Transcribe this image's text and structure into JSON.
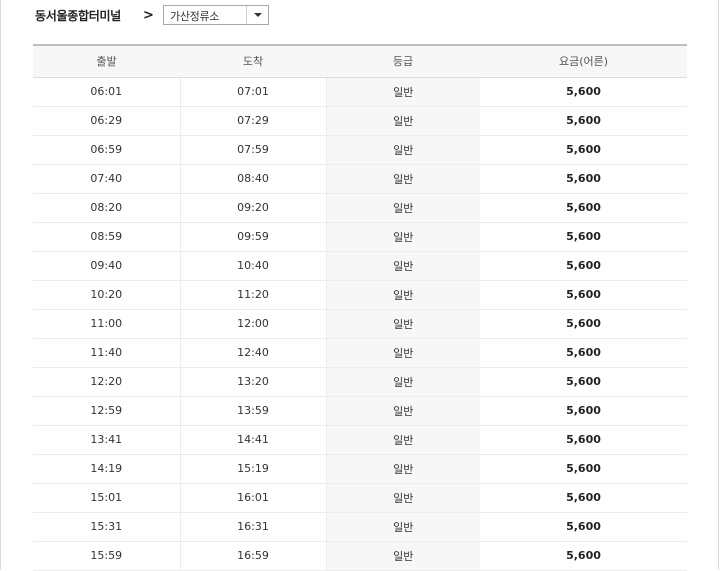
{
  "route": {
    "origin": "동서울종합터미널",
    "arrow": ">",
    "destination_select": {
      "value": "가산정류소"
    }
  },
  "table": {
    "headers": {
      "departure": "출발",
      "arrival": "도착",
      "grade": "등급",
      "fare": "요금(어른)"
    },
    "rows": [
      {
        "departure": "06:01",
        "arrival": "07:01",
        "grade": "일반",
        "fare": "5,600"
      },
      {
        "departure": "06:29",
        "arrival": "07:29",
        "grade": "일반",
        "fare": "5,600"
      },
      {
        "departure": "06:59",
        "arrival": "07:59",
        "grade": "일반",
        "fare": "5,600"
      },
      {
        "departure": "07:40",
        "arrival": "08:40",
        "grade": "일반",
        "fare": "5,600"
      },
      {
        "departure": "08:20",
        "arrival": "09:20",
        "grade": "일반",
        "fare": "5,600"
      },
      {
        "departure": "08:59",
        "arrival": "09:59",
        "grade": "일반",
        "fare": "5,600"
      },
      {
        "departure": "09:40",
        "arrival": "10:40",
        "grade": "일반",
        "fare": "5,600"
      },
      {
        "departure": "10:20",
        "arrival": "11:20",
        "grade": "일반",
        "fare": "5,600"
      },
      {
        "departure": "11:00",
        "arrival": "12:00",
        "grade": "일반",
        "fare": "5,600"
      },
      {
        "departure": "11:40",
        "arrival": "12:40",
        "grade": "일반",
        "fare": "5,600"
      },
      {
        "departure": "12:20",
        "arrival": "13:20",
        "grade": "일반",
        "fare": "5,600"
      },
      {
        "departure": "12:59",
        "arrival": "13:59",
        "grade": "일반",
        "fare": "5,600"
      },
      {
        "departure": "13:41",
        "arrival": "14:41",
        "grade": "일반",
        "fare": "5,600"
      },
      {
        "departure": "14:19",
        "arrival": "15:19",
        "grade": "일반",
        "fare": "5,600"
      },
      {
        "departure": "15:01",
        "arrival": "16:01",
        "grade": "일반",
        "fare": "5,600"
      },
      {
        "departure": "15:31",
        "arrival": "16:31",
        "grade": "일반",
        "fare": "5,600"
      },
      {
        "departure": "15:59",
        "arrival": "16:59",
        "grade": "일반",
        "fare": "5,600"
      }
    ]
  }
}
